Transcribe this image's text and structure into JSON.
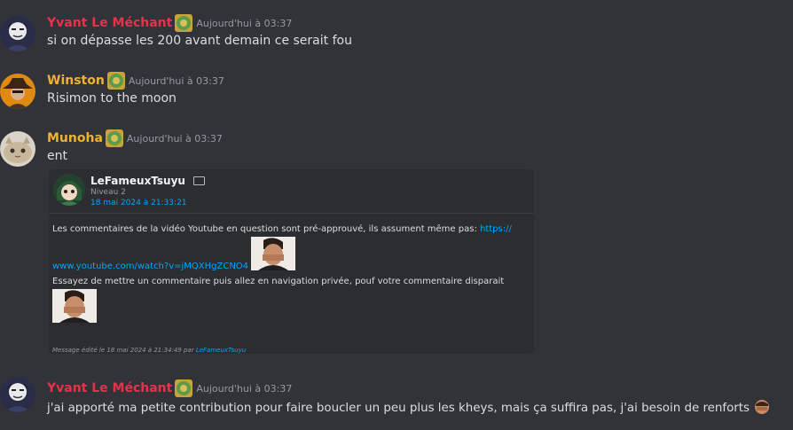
{
  "colors": {
    "background": "#313338",
    "yvant_name": "#e8314a",
    "gold_name": "#f0b232",
    "timestamp": "#949ba4",
    "link": "#00a8fc",
    "embed_bg": "#2b2d31"
  },
  "messages": [
    {
      "author": "Yvant Le Méchant",
      "timestamp": "Aujourd'hui à 03:37",
      "text": "si on dépasse les 200 avant demain ce serait fou"
    },
    {
      "author": "Winston",
      "timestamp": "Aujourd'hui à 03:37",
      "text": "Risimon to the moon"
    },
    {
      "author": "Munoha",
      "timestamp": "Aujourd'hui à 03:37",
      "text": "ent"
    },
    {
      "author": "Yvant Le Méchant",
      "timestamp": "Aujourd'hui à 03:37",
      "text": "j'ai apporté ma petite contribution pour faire boucler un peu plus les kheys, mais ça suffira pas, j'ai besoin de renforts"
    }
  ],
  "embed": {
    "author": "LeFameuxTsuyu",
    "level": "Niveau 2",
    "date": "18 mai 2024 à 21:33:21",
    "line1": "Les commentaires de la vidéo Youtube en question sont pré-approuvé, ils assument même pas: ",
    "link_part1": "https://",
    "link_part2": "www.youtube.com/watch?v=jMQXHgZCNO4",
    "line3": "Essayez de mettre un commentaire puis allez en navigation privée, pouf votre commentaire disparait",
    "edit_note": "Message édité le 18 mai 2024 à 21:34:49 par ",
    "edit_author": "LeFameuxTsuyu"
  }
}
